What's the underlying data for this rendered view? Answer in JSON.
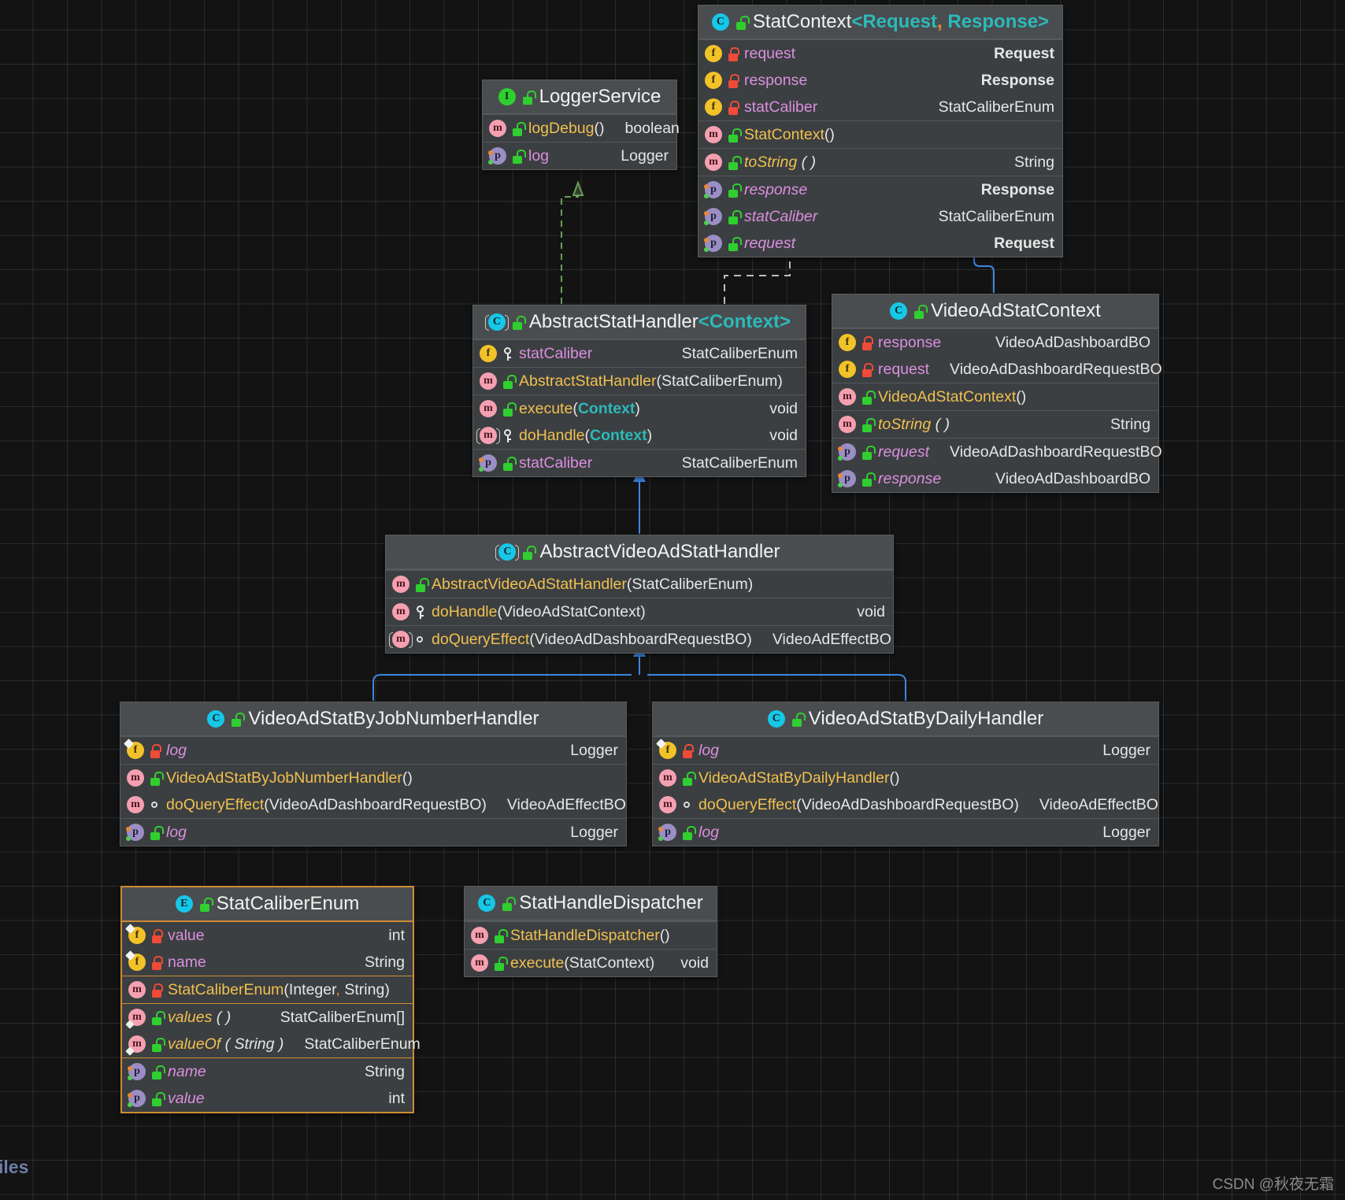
{
  "meta": {
    "watermark": "CSDN @秋夜无霜",
    "left_edge_text": "iles"
  },
  "colors": {
    "canvas": "#131313",
    "box_bg": "#3c3f41",
    "header_bg": "#4a4d4f",
    "selected_border": "#cc8b35",
    "inherit_arrow": "#3d87e0",
    "implement_arrow": "#6a9c5a",
    "generic_teal": "#2cb9b9",
    "field_purple": "#d98fe0",
    "method_gold": "#f0c050",
    "void_orange": "#e8883a"
  },
  "classes": [
    {
      "id": "StatContext",
      "name": "StatContext",
      "generics": "<Request, Response>",
      "kind": "class",
      "icon": "class-icon",
      "visibility": "public",
      "selected": false,
      "members": [
        {
          "icon": "field-icon",
          "vis": "private",
          "name": "request",
          "type": "Request",
          "type_style": "generic",
          "italic": false,
          "divider": false
        },
        {
          "icon": "field-icon",
          "vis": "private",
          "name": "response",
          "type": "Response",
          "type_style": "generic",
          "italic": false,
          "divider": false
        },
        {
          "icon": "field-icon",
          "vis": "private",
          "name": "statCaliber",
          "type": "StatCaliberEnum",
          "type_style": "plain",
          "italic": false,
          "divider": false
        },
        {
          "icon": "method-icon",
          "vis": "public",
          "name": "StatContext()",
          "type": "",
          "type_style": "plain",
          "italic": false,
          "divider": true
        },
        {
          "icon": "method-icon",
          "vis": "public",
          "name": "toString ( )",
          "type": "String",
          "type_style": "plain",
          "italic": true,
          "divider": true
        },
        {
          "icon": "property-icon",
          "vis": "public",
          "name": "response",
          "type": "Response",
          "type_style": "generic",
          "italic": true,
          "divider": true
        },
        {
          "icon": "property-icon",
          "vis": "public",
          "name": "statCaliber",
          "type": "StatCaliberEnum",
          "type_style": "plain",
          "italic": true,
          "divider": false
        },
        {
          "icon": "property-icon",
          "vis": "public",
          "name": "request",
          "type": "Request",
          "type_style": "generic",
          "italic": true,
          "divider": false
        }
      ]
    },
    {
      "id": "LoggerService",
      "name": "LoggerService",
      "generics": "",
      "kind": "interface",
      "icon": "interface-icon",
      "visibility": "public",
      "selected": false,
      "members": [
        {
          "icon": "method-icon",
          "vis": "public",
          "name": "logDebug()",
          "type": "boolean",
          "type_style": "void",
          "italic": false,
          "divider": false
        },
        {
          "icon": "property-icon",
          "vis": "public",
          "name": "log",
          "type": "Logger",
          "type_style": "plain",
          "italic": false,
          "divider": true
        }
      ]
    },
    {
      "id": "AbstractStatHandler",
      "name": "AbstractStatHandler",
      "generics": "<Context>",
      "kind": "abstract-class",
      "icon": "abstract-class-icon",
      "visibility": "public",
      "selected": false,
      "members": [
        {
          "icon": "field-icon",
          "vis": "protected",
          "name": "statCaliber",
          "type": "StatCaliberEnum",
          "type_style": "plain",
          "italic": false,
          "divider": false
        },
        {
          "icon": "method-icon",
          "vis": "public",
          "name": "AbstractStatHandler(StatCaliberEnum)",
          "type": "",
          "type_style": "plain",
          "italic": false,
          "divider": true
        },
        {
          "icon": "method-icon",
          "vis": "public",
          "name": "execute(Context)",
          "type": "void",
          "type_style": "void",
          "italic": false,
          "divider": true,
          "generic_arg": "Context"
        },
        {
          "icon": "abstract-method-icon",
          "vis": "protected",
          "name": "doHandle(Context)",
          "type": "void",
          "type_style": "void",
          "italic": false,
          "divider": false,
          "generic_arg": "Context"
        },
        {
          "icon": "property-icon",
          "vis": "public",
          "name": "statCaliber",
          "type": "StatCaliberEnum",
          "type_style": "plain",
          "italic": false,
          "divider": true
        }
      ]
    },
    {
      "id": "VideoAdStatContext",
      "name": "VideoAdStatContext",
      "generics": "",
      "kind": "class",
      "icon": "class-icon",
      "visibility": "public",
      "selected": false,
      "members": [
        {
          "icon": "field-icon",
          "vis": "private",
          "name": "response",
          "type": "VideoAdDashboardBO",
          "type_style": "plain",
          "italic": false,
          "divider": false
        },
        {
          "icon": "field-icon",
          "vis": "private",
          "name": "request",
          "type": "VideoAdDashboardRequestBO",
          "type_style": "plain",
          "italic": false,
          "divider": false
        },
        {
          "icon": "method-icon",
          "vis": "public",
          "name": "VideoAdStatContext()",
          "type": "",
          "type_style": "plain",
          "italic": false,
          "divider": true
        },
        {
          "icon": "method-icon",
          "vis": "public",
          "name": "toString ( )",
          "type": "String",
          "type_style": "plain",
          "italic": true,
          "divider": true
        },
        {
          "icon": "property-icon",
          "vis": "public",
          "name": "request",
          "type": "VideoAdDashboardRequestBO",
          "type_style": "plain",
          "italic": true,
          "divider": true
        },
        {
          "icon": "property-icon",
          "vis": "public",
          "name": "response",
          "type": "VideoAdDashboardBO",
          "type_style": "plain",
          "italic": true,
          "divider": false
        }
      ]
    },
    {
      "id": "AbstractVideoAdStatHandler",
      "name": "AbstractVideoAdStatHandler",
      "generics": "",
      "kind": "abstract-class",
      "icon": "abstract-class-icon",
      "visibility": "public",
      "selected": false,
      "members": [
        {
          "icon": "method-icon",
          "vis": "public",
          "name": "AbstractVideoAdStatHandler(StatCaliberEnum)",
          "type": "",
          "type_style": "plain",
          "italic": false,
          "divider": true
        },
        {
          "icon": "method-icon",
          "vis": "protected",
          "name": "doHandle(VideoAdStatContext)",
          "type": "void",
          "type_style": "void",
          "italic": false,
          "divider": true
        },
        {
          "icon": "abstract-method-icon",
          "vis": "package-private",
          "name": "doQueryEffect(VideoAdDashboardRequestBO)",
          "type": "VideoAdEffectBO",
          "type_style": "plain",
          "italic": false,
          "divider": true
        }
      ]
    },
    {
      "id": "VideoAdStatByJobNumberHandler",
      "name": "VideoAdStatByJobNumberHandler",
      "generics": "",
      "kind": "class",
      "icon": "class-icon",
      "visibility": "public",
      "selected": false,
      "members": [
        {
          "icon": "static-final-field-icon",
          "vis": "private",
          "name": "log",
          "type": "Logger",
          "type_style": "plain",
          "italic": true,
          "divider": false
        },
        {
          "icon": "method-icon",
          "vis": "public",
          "name": "VideoAdStatByJobNumberHandler()",
          "type": "",
          "type_style": "plain",
          "italic": false,
          "divider": true
        },
        {
          "icon": "method-icon",
          "vis": "package-private",
          "name": "doQueryEffect(VideoAdDashboardRequestBO)",
          "type": "VideoAdEffectBO",
          "type_style": "plain",
          "italic": false,
          "divider": false
        },
        {
          "icon": "property-icon",
          "vis": "public",
          "name": "log",
          "type": "Logger",
          "type_style": "plain",
          "italic": true,
          "divider": true
        }
      ]
    },
    {
      "id": "VideoAdStatByDailyHandler",
      "name": "VideoAdStatByDailyHandler",
      "generics": "",
      "kind": "class",
      "icon": "class-icon",
      "visibility": "public",
      "selected": false,
      "members": [
        {
          "icon": "static-final-field-icon",
          "vis": "private",
          "name": "log",
          "type": "Logger",
          "type_style": "plain",
          "italic": true,
          "divider": false
        },
        {
          "icon": "method-icon",
          "vis": "public",
          "name": "VideoAdStatByDailyHandler()",
          "type": "",
          "type_style": "plain",
          "italic": false,
          "divider": true
        },
        {
          "icon": "method-icon",
          "vis": "package-private",
          "name": "doQueryEffect(VideoAdDashboardRequestBO)",
          "type": "VideoAdEffectBO",
          "type_style": "plain",
          "italic": false,
          "divider": false
        },
        {
          "icon": "property-icon",
          "vis": "public",
          "name": "log",
          "type": "Logger",
          "type_style": "plain",
          "italic": true,
          "divider": true
        }
      ]
    },
    {
      "id": "StatCaliberEnum",
      "name": "StatCaliberEnum",
      "generics": "",
      "kind": "enum",
      "icon": "enum-icon",
      "visibility": "public",
      "selected": true,
      "members": [
        {
          "icon": "static-final-field-icon",
          "vis": "private",
          "name": "value",
          "type": "int",
          "type_style": "void",
          "italic": false,
          "divider": false
        },
        {
          "icon": "static-final-field-icon",
          "vis": "private",
          "name": "name",
          "type": "String",
          "type_style": "plain",
          "italic": false,
          "divider": false
        },
        {
          "icon": "method-icon",
          "vis": "private",
          "name": "StatCaliberEnum(Integer, String)",
          "type": "",
          "type_style": "plain",
          "italic": false,
          "divider": true
        },
        {
          "icon": "static-method-icon",
          "vis": "public",
          "name": "values ( )",
          "type": "StatCaliberEnum[]",
          "type_style": "plain",
          "italic": true,
          "divider": true
        },
        {
          "icon": "static-method-icon",
          "vis": "public",
          "name": "valueOf ( String )",
          "type": "StatCaliberEnum",
          "type_style": "plain",
          "italic": true,
          "divider": false
        },
        {
          "icon": "property-icon",
          "vis": "public",
          "name": "name",
          "type": "String",
          "type_style": "plain",
          "italic": true,
          "divider": true
        },
        {
          "icon": "property-icon",
          "vis": "public",
          "name": "value",
          "type": "int",
          "type_style": "void",
          "italic": true,
          "divider": false
        }
      ]
    },
    {
      "id": "StatHandleDispatcher",
      "name": "StatHandleDispatcher",
      "generics": "",
      "kind": "class",
      "icon": "class-icon",
      "visibility": "public",
      "selected": false,
      "members": [
        {
          "icon": "method-icon",
          "vis": "public",
          "name": "StatHandleDispatcher()",
          "type": "",
          "type_style": "plain",
          "italic": false,
          "divider": true
        },
        {
          "icon": "method-icon",
          "vis": "public",
          "name": "execute(StatContext)",
          "type": "void",
          "type_style": "void",
          "italic": false,
          "divider": true
        }
      ]
    }
  ],
  "relations": [
    {
      "from": "AbstractStatHandler",
      "to": "LoggerService",
      "type": "implements",
      "style": "dashed",
      "color": "#6a9c5a"
    },
    {
      "from": "AbstractStatHandler",
      "to": "StatContext",
      "type": "dependency",
      "style": "dashed",
      "color": "#d4d4d4"
    },
    {
      "from": "VideoAdStatContext",
      "to": "StatContext",
      "type": "extends",
      "style": "solid",
      "color": "#3d87e0"
    },
    {
      "from": "AbstractVideoAdStatHandler",
      "to": "AbstractStatHandler",
      "type": "extends",
      "style": "solid",
      "color": "#3d87e0"
    },
    {
      "from": "VideoAdStatByJobNumberHandler",
      "to": "AbstractVideoAdStatHandler",
      "type": "extends",
      "style": "solid",
      "color": "#3d87e0"
    },
    {
      "from": "VideoAdStatByDailyHandler",
      "to": "AbstractVideoAdStatHandler",
      "type": "extends",
      "style": "solid",
      "color": "#3d87e0"
    }
  ]
}
